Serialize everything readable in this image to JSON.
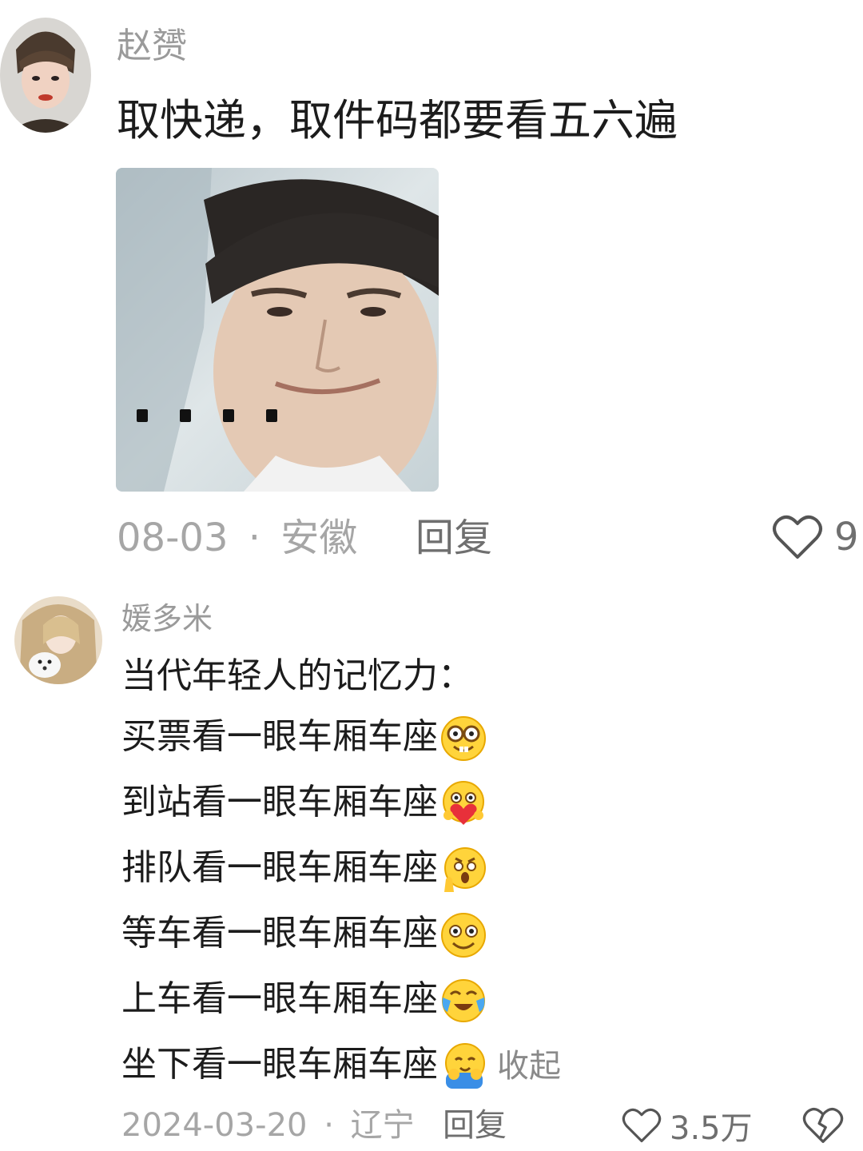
{
  "comment1": {
    "username": "赵赟",
    "text": "取快递，取件码都要看五六遍",
    "date": "08-03",
    "separator": "·",
    "location": "安徽",
    "reply_label": "回复",
    "like_count": "9"
  },
  "comment2": {
    "username": "媛多米",
    "lines": [
      "当代年轻人的记忆力：",
      "买票看一眼车厢车座",
      "到站看一眼车厢车座",
      "排队看一眼车厢车座",
      "等车看一眼车厢车座",
      "上车看一眼车厢车座",
      "坐下看一眼车厢车座"
    ],
    "collapse_label": "收起",
    "date": "2024-03-20",
    "separator": "·",
    "location": "辽宁",
    "reply_label": "回复",
    "like_count": "3.5万"
  },
  "icons": {
    "like": "heart-outline-icon",
    "dislike": "broken-heart-icon",
    "emoji1": "nerd-face-emoji",
    "emoji2": "face-holding-heart-emoji",
    "emoji3": "shocked-face-emoji",
    "emoji4": "smiling-face-emoji",
    "emoji5": "crying-laughing-emoji",
    "emoji6": "hugging-face-emoji"
  }
}
